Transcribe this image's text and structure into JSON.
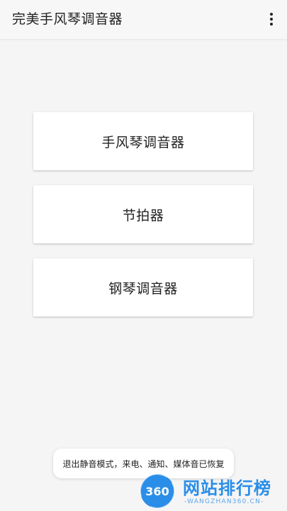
{
  "app_bar": {
    "title": "完美手风琴调音器",
    "overflow_icon": "more-vert-icon"
  },
  "menu": [
    {
      "label": "手风琴调音器"
    },
    {
      "label": "节拍器"
    },
    {
      "label": "钢琴调音器"
    }
  ],
  "toast": {
    "message": "退出静音模式，来电、通知、媒体音已恢复"
  },
  "watermark": {
    "logo_text": "360",
    "title": "网站排行榜",
    "subtitle": "-WANGZHAN360.CN-",
    "color": "#2a8ee8"
  }
}
